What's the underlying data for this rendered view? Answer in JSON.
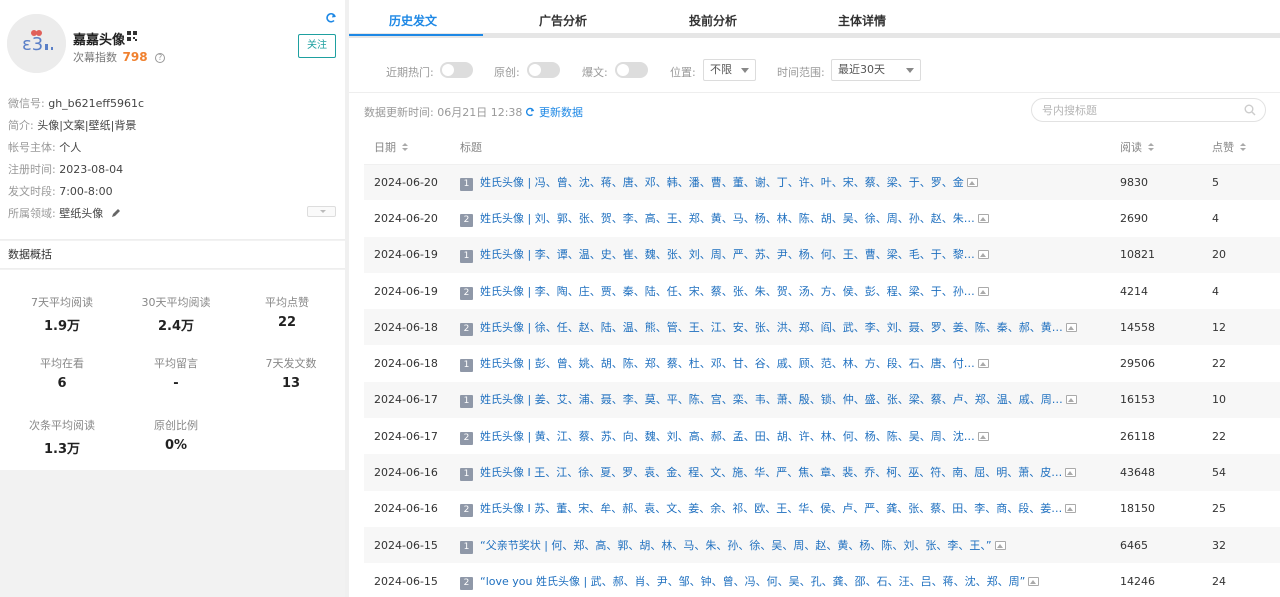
{
  "account": {
    "name": "嘉嘉头像",
    "index_label": "次幕指数",
    "index_value": "798",
    "follow_label": "关注"
  },
  "info": {
    "wechat_id_label": "微信号:",
    "wechat_id": "gh_b621eff5961c",
    "intro_label": "简介:",
    "intro": "头像|文案|壁纸|背景",
    "owner_label": "帐号主体:",
    "owner": "个人",
    "reg_label": "注册时间:",
    "reg_date": "2023-08-04",
    "post_time_label": "发文时段:",
    "post_time": "7:00-8:00",
    "domain_label": "所属领域:",
    "domain": "壁纸头像"
  },
  "overview": {
    "title": "数据概括",
    "stats": [
      {
        "label": "7天平均阅读",
        "value": "1.9万"
      },
      {
        "label": "30天平均阅读",
        "value": "2.4万"
      },
      {
        "label": "平均点赞",
        "value": "22"
      },
      {
        "label": "平均在看",
        "value": "6"
      },
      {
        "label": "平均留言",
        "value": "-"
      },
      {
        "label": "7天发文数",
        "value": "13"
      },
      {
        "label": "次条平均阅读",
        "value": "1.3万"
      },
      {
        "label": "原创比例",
        "value": "0%"
      }
    ]
  },
  "tabs": [
    "历史发文",
    "广告分析",
    "投前分析",
    "主体详情"
  ],
  "filters": {
    "hot_label": "近期热门:",
    "original_label": "原创:",
    "viral_label": "爆文:",
    "position_label": "位置:",
    "position_value": "不限",
    "range_label": "时间范围:",
    "range_value": "最近30天"
  },
  "update": {
    "text": "数据更新时间:  06月21日 12:38",
    "refresh_label": "更新数据"
  },
  "search": {
    "placeholder": "号内搜标题"
  },
  "table": {
    "headers": {
      "date": "日期",
      "title": "标题",
      "reads": "阅读",
      "likes": "点赞"
    },
    "rows": [
      {
        "date": "2024-06-20",
        "pos": "1",
        "title": "姓氏头像 | 冯、曾、沈、蒋、唐、邓、韩、潘、曹、董、谢、丁、许、叶、宋、蔡、梁、于、罗、金",
        "reads": "9830",
        "likes": "5"
      },
      {
        "date": "2024-06-20",
        "pos": "2",
        "title": "姓氏头像 | 刘、郭、张、贺、李、高、王、郑、黄、马、杨、林、陈、胡、吴、徐、周、孙、赵、朱…",
        "reads": "2690",
        "likes": "4"
      },
      {
        "date": "2024-06-19",
        "pos": "1",
        "title": "姓氏头像 | 李、谭、温、史、崔、魏、张、刘、周、严、苏、尹、杨、何、王、曹、梁、毛、于、黎…",
        "reads": "10821",
        "likes": "20"
      },
      {
        "date": "2024-06-19",
        "pos": "2",
        "title": "姓氏头像 | 李、陶、庄、贾、秦、陆、任、宋、蔡、张、朱、贺、汤、方、侯、彭、程、梁、于、孙…",
        "reads": "4214",
        "likes": "4"
      },
      {
        "date": "2024-06-18",
        "pos": "2",
        "title": "姓氏头像 | 徐、任、赵、陆、温、熊、管、王、江、安、张、洪、郑、阎、武、李、刘、聂、罗、姜、陈、秦、郝、黄…",
        "reads": "14558",
        "likes": "12"
      },
      {
        "date": "2024-06-18",
        "pos": "1",
        "title": "姓氏头像 | 彭、曾、姚、胡、陈、郑、蔡、杜、邓、甘、谷、戚、顾、范、林、方、段、石、唐、付…",
        "reads": "29506",
        "likes": "22"
      },
      {
        "date": "2024-06-17",
        "pos": "1",
        "title": "姓氏头像 | 姜、艾、浦、聂、李、莫、平、陈、宫、栾、韦、萧、殷、锁、仲、盛、张、梁、蔡、卢、郑、温、戚、周…",
        "reads": "16153",
        "likes": "10"
      },
      {
        "date": "2024-06-17",
        "pos": "2",
        "title": "姓氏头像 | 黄、江、蔡、苏、向、魏、刘、高、郝、孟、田、胡、许、林、何、杨、陈、吴、周、沈…",
        "reads": "26118",
        "likes": "22"
      },
      {
        "date": "2024-06-16",
        "pos": "1",
        "title": "姓氏头像 I 王、江、徐、夏、罗、袁、金、程、文、施、华、严、焦、章、裴、乔、柯、巫、符、南、屈、明、萧、皮…",
        "reads": "43648",
        "likes": "54"
      },
      {
        "date": "2024-06-16",
        "pos": "2",
        "title": "姓氏头像 I 苏、董、宋、牟、郝、袁、文、姜、余、祁、欧、王、华、侯、卢、严、龚、张、蔡、田、李、商、段、姜…",
        "reads": "18150",
        "likes": "25"
      },
      {
        "date": "2024-06-15",
        "pos": "1",
        "title": "“父亲节奖状 | 何、郑、高、郭、胡、林、马、朱、孙、徐、吴、周、赵、黄、杨、陈、刘、张、李、王、”",
        "reads": "6465",
        "likes": "32"
      },
      {
        "date": "2024-06-15",
        "pos": "2",
        "title": "“love you 姓氏头像 | 武、郝、肖、尹、邹、钟、曾、冯、何、吴、孔、龚、邵、石、汪、吕、蒋、沈、郑、周”",
        "reads": "14246",
        "likes": "24"
      }
    ]
  }
}
